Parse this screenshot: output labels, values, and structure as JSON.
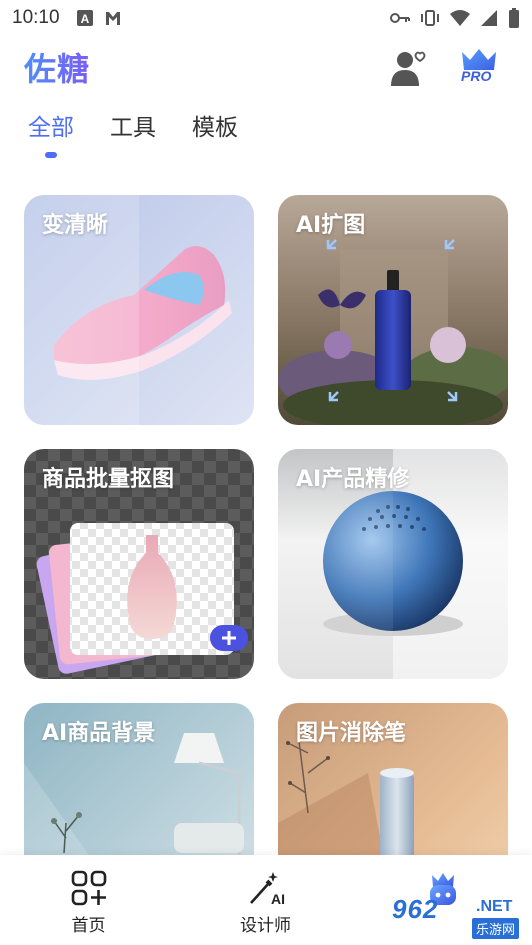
{
  "status_bar": {
    "time": "10:10",
    "left_icons": [
      "font-a-icon",
      "gmail-icon"
    ],
    "right_icons": [
      "key-icon",
      "vibrate-icon",
      "wifi-icon",
      "signal-icon",
      "battery-icon"
    ]
  },
  "header": {
    "title": "佐糖",
    "profile_icon": "user-heart-icon",
    "pro_label": "PRO"
  },
  "tabs": [
    {
      "label": "全部",
      "active": true
    },
    {
      "label": "工具",
      "active": false
    },
    {
      "label": "模板",
      "active": false
    }
  ],
  "cards": [
    {
      "label": "变清晰"
    },
    {
      "label": "AI扩图"
    },
    {
      "label": "商品批量抠图"
    },
    {
      "label": "AI产品精修"
    },
    {
      "label": "AI商品背景"
    },
    {
      "label": "图片消除笔"
    }
  ],
  "bottom_nav": [
    {
      "label": "首页",
      "icon": "grid-plus-icon"
    },
    {
      "label": "设计师",
      "icon": "magic-wand-ai-icon"
    },
    {
      "label": "",
      "icon": "crown-bot-icon"
    }
  ],
  "watermark": {
    "brand": "962",
    "net": ".NET",
    "sub": "乐游网"
  },
  "colors": {
    "accent": "#4f6ff2",
    "title_gradient_start": "#4f8ef7",
    "title_gradient_end": "#7b5cf6"
  }
}
